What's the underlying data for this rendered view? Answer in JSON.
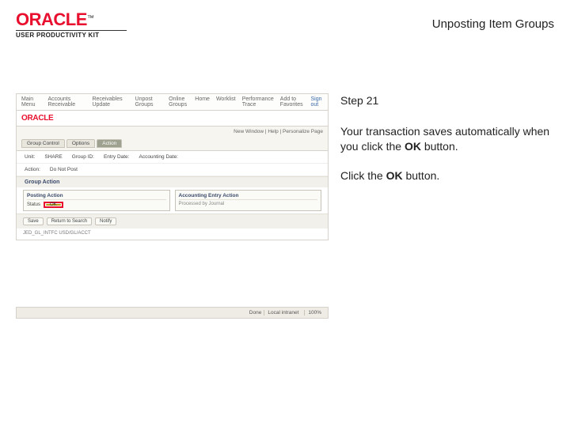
{
  "header": {
    "brand": "ORACLE",
    "trademark": "™",
    "subline": "USER PRODUCTIVITY KIT",
    "page_title": "Unposting Item Groups"
  },
  "instructions": {
    "step_label": "Step 21",
    "para1_pre": "Your transaction saves automatically when you click the ",
    "para1_bold": "OK",
    "para1_post": " button.",
    "para2_pre": "Click the ",
    "para2_bold": "OK",
    "para2_post": " button."
  },
  "screenshot": {
    "top_menu": {
      "m1": "Main Menu",
      "m2": "Accounts Receivable",
      "m3": "Receivables Update",
      "m4": "Unpost Groups",
      "m5": "Online Groups",
      "m6": "Home",
      "m7": "Worklist",
      "m8": "Performance Trace",
      "m9": "Add to Favorites",
      "signout": "Sign out"
    },
    "logo": "ORACLE",
    "personalize": "New Window | Help | Personalize Page",
    "tabs": {
      "t1": "Group Control",
      "t2": "Options",
      "t3": "Action"
    },
    "row1": {
      "k1": "Unit:",
      "v1": "SHARE",
      "k2": "Group ID:",
      "k3": "Entry Date:",
      "k4": "Accounting Date:"
    },
    "row2": {
      "k1": "Action:",
      "v1": "Do Not Post"
    },
    "section": "Group Action",
    "box1": {
      "title": "Posting Action",
      "label": "Status",
      "ok": "OK"
    },
    "box2": {
      "title": "Accounting Entry Action",
      "body": "Processed by Journal"
    },
    "actions": {
      "save": "Save",
      "returnsearch": "Return to Search",
      "notify": "Notify"
    },
    "footer": "JED_GL_INTFC   USD/GL/ACCT"
  },
  "status": {
    "done": "Done",
    "zone": "Local intranet",
    "zoom": "100%"
  }
}
